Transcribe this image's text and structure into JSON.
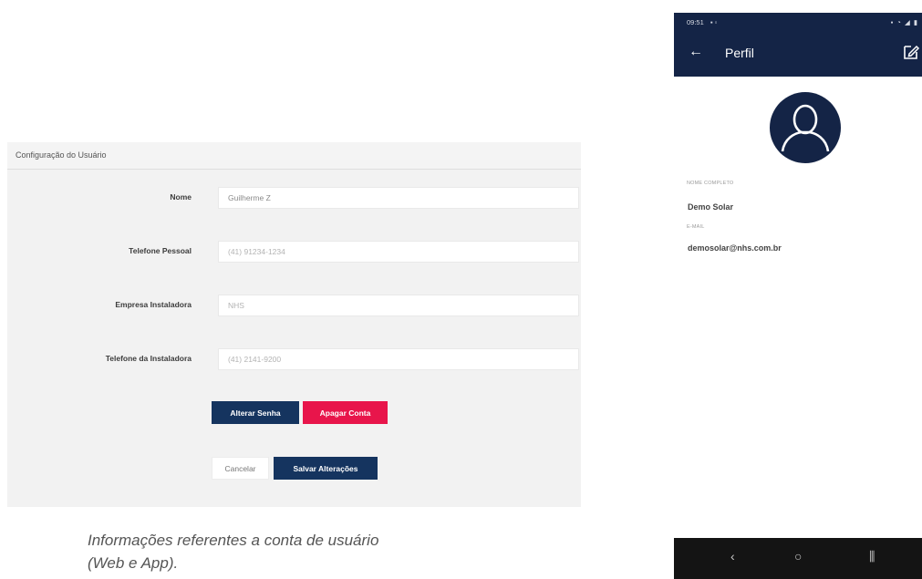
{
  "web": {
    "header_title": "Configuração do Usuário",
    "fields": [
      {
        "label": "Nome",
        "value": "Guilherme Z"
      },
      {
        "label": "Telefone Pessoal",
        "value": "(41) 91234-1234"
      },
      {
        "label": "Empresa Instaladora",
        "value": "NHS"
      },
      {
        "label": "Telefone da Instaladora",
        "value": "(41) 2141-9200"
      }
    ],
    "buttons": {
      "change_password": "Alterar Senha",
      "delete_account": "Apagar Conta",
      "cancel": "Cancelar",
      "save": "Salvar Alterações"
    },
    "colors": {
      "navy": "#15345f",
      "red": "#e8154b"
    }
  },
  "caption": {
    "line1": "Informações referentes a conta de usuário",
    "line2": "(Web e App)."
  },
  "app": {
    "status_time": "09:51",
    "title": "Perfil",
    "back_icon": "arrow-left-icon",
    "edit_icon": "edit-icon",
    "avatar_icon": "user-avatar-icon",
    "name_label": "NOME COMPLETO",
    "name_value": "Demo Solar",
    "email_label": "E-MAIL",
    "email_value": "demosolar@nhs.com.br",
    "nav": {
      "back": "‹",
      "home": "○",
      "recents": "⫼"
    },
    "colors": {
      "app_bar": "#142446",
      "nav_bar": "#141414"
    }
  }
}
